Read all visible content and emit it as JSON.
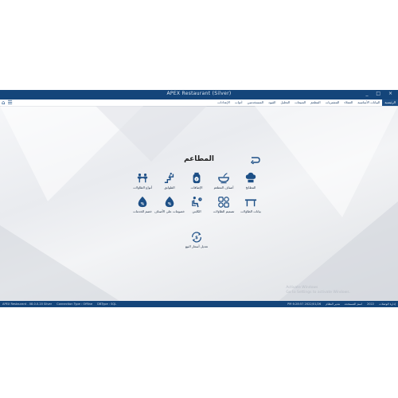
{
  "window": {
    "title": "APEX Restaurant (Silver)",
    "controls": "_ □ ×"
  },
  "menu": {
    "items": [
      "الرئيسية",
      "البيانات الأساسية",
      "العملاء",
      "المشتريات",
      "المطعم",
      "المبيعات",
      "التحليل",
      "القيود",
      "المستخدمين",
      "أدوات",
      "الإعدادات"
    ],
    "active_index": 0
  },
  "panel": {
    "title": "المطاعم"
  },
  "tiles": [
    {
      "label": "المطابخ",
      "icon": "chef-hat-icon"
    },
    {
      "label": "أصناف المطعم",
      "icon": "food-bowl-icon"
    },
    {
      "label": "الإضافات",
      "icon": "add-ons-icon"
    },
    {
      "label": "الطوابق",
      "icon": "stairs-icon"
    },
    {
      "label": "أنواع الطاولات",
      "icon": "dining-table-icon"
    },
    {
      "label": "بيانات الطاولات",
      "icon": "table-icon"
    },
    {
      "label": "تصميم الطاولات",
      "icon": "grid-layout-icon"
    },
    {
      "label": "الكابتن",
      "icon": "seated-person-icon"
    },
    {
      "label": "خصومات على الأصناف",
      "icon": "item-discount-icon"
    },
    {
      "label": "خصم الخدمات",
      "icon": "service-discount-icon"
    },
    {
      "label": "تعديل أسعار البيع",
      "icon": "price-edit-icon"
    }
  ],
  "status": {
    "left": [
      "APEX Restaurant - 08.0.0.20 Silver",
      "Connection Type : Offline",
      "DBType : SQL"
    ],
    "right": [
      "PM 6:28:57 2022/01/26",
      "إدارة الوصلات",
      "2022",
      "اسم المستخدم",
      "مدير النظام"
    ]
  },
  "watermark": [
    "Activate Windows",
    "Go to Settings to activate Windows."
  ],
  "colors": {
    "primary": "#14457a",
    "icon": "#1d4f86",
    "background": "#ffffff"
  }
}
